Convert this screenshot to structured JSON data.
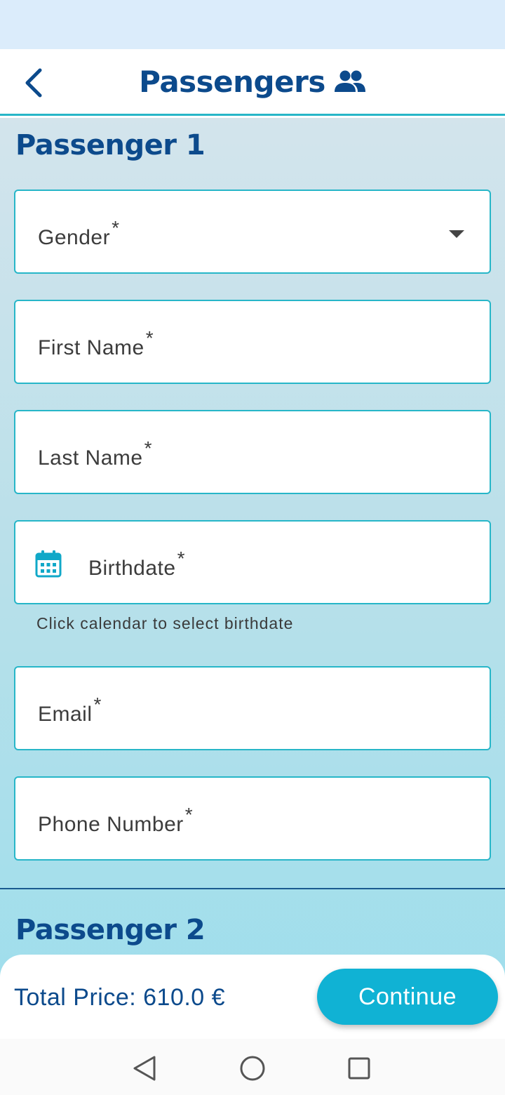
{
  "header": {
    "title": "Passengers"
  },
  "passengers": [
    {
      "heading": "Passenger 1",
      "fields": {
        "gender": {
          "label": "Gender",
          "required_mark": "*"
        },
        "first_name": {
          "label": "First Name",
          "required_mark": "*"
        },
        "last_name": {
          "label": "Last Name",
          "required_mark": "*"
        },
        "birthdate": {
          "label": "Birthdate",
          "required_mark": "*",
          "helper": "Click calendar to select birthdate"
        },
        "email": {
          "label": "Email",
          "required_mark": "*"
        },
        "phone": {
          "label": "Phone Number",
          "required_mark": "*"
        }
      }
    },
    {
      "heading": "Passenger 2"
    }
  ],
  "footer": {
    "total_price": "Total Price: 610.0 €",
    "continue_label": "Continue"
  },
  "icons": {
    "back": "chevron-left-icon",
    "passengers": "people-icon",
    "dropdown": "caret-down-icon",
    "calendar": "calendar-icon",
    "nav_back": "triangle-back-icon",
    "nav_home": "circle-home-icon",
    "nav_recents": "square-recents-icon"
  },
  "colors": {
    "primary": "#0c4a8c",
    "accent": "#27b6c8",
    "button": "#10b2d4"
  }
}
